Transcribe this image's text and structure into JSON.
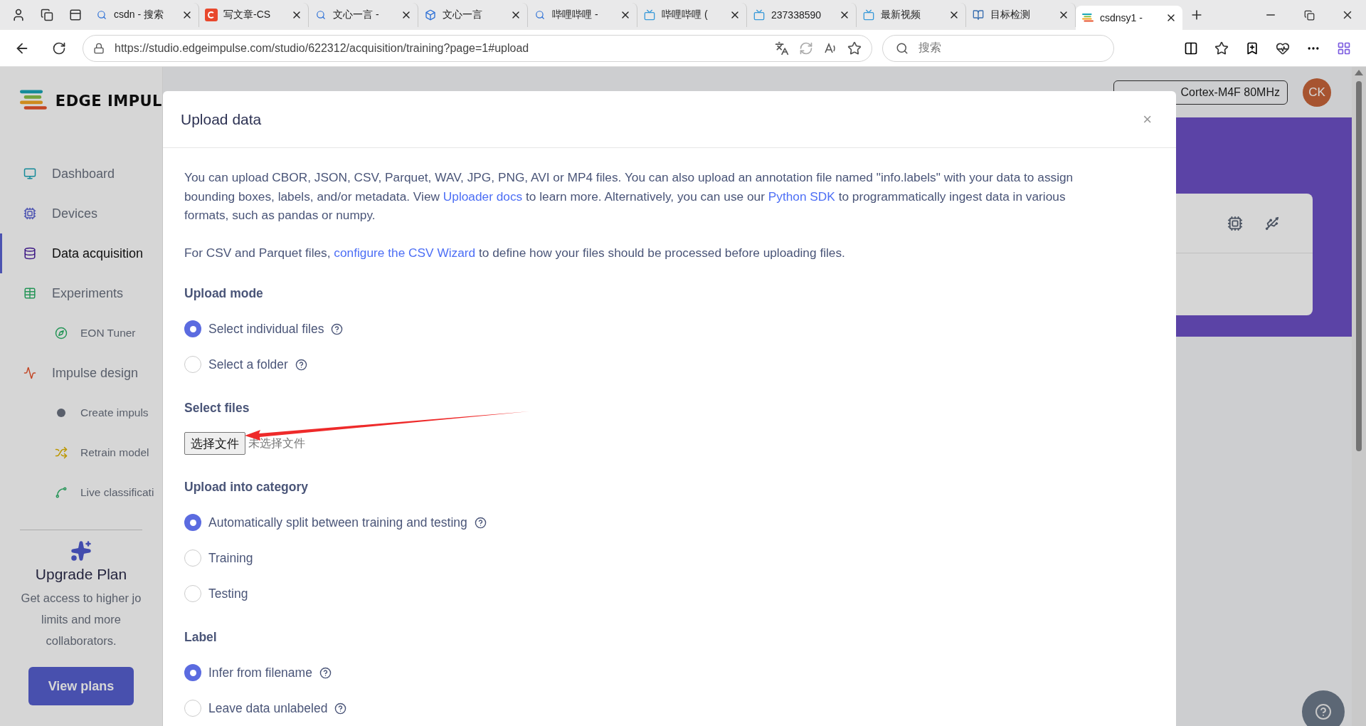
{
  "browser": {
    "tabs": [
      {
        "title": "csdn - 搜索",
        "kind": "search",
        "selected": false
      },
      {
        "title": "写文章-CS",
        "kind": "csdn",
        "selected": false
      },
      {
        "title": "文心一言 -",
        "kind": "search",
        "selected": false
      },
      {
        "title": "文心一言",
        "kind": "cube",
        "selected": false
      },
      {
        "title": "哔哩哔哩 -",
        "kind": "search",
        "selected": false
      },
      {
        "title": "哔哩哔哩 (",
        "kind": "tv",
        "selected": false
      },
      {
        "title": "237338590",
        "kind": "tv",
        "selected": false
      },
      {
        "title": "最新视频",
        "kind": "tv",
        "selected": false
      },
      {
        "title": "目标检测",
        "kind": "book",
        "selected": false
      },
      {
        "title": "csdnsy1 -",
        "kind": "logo",
        "selected": true
      }
    ],
    "url": "https://studio.edgeimpulse.com/studio/622312/acquisition/training?page=1#upload",
    "search_placeholder": "搜索"
  },
  "sidebar": {
    "logo_text": "EDGE IMPUL",
    "items": [
      {
        "label": "Dashboard",
        "kind": "dashboard",
        "sub": false,
        "selected": false
      },
      {
        "label": "Devices",
        "kind": "devices",
        "sub": false,
        "selected": false
      },
      {
        "label": "Data acquisition",
        "kind": "data",
        "sub": false,
        "selected": true
      },
      {
        "label": "Experiments",
        "kind": "experiments",
        "sub": false,
        "selected": false
      },
      {
        "label": "EON Tuner",
        "kind": "eon",
        "sub": true,
        "selected": false
      },
      {
        "label": "Impulse design",
        "kind": "impulse",
        "sub": false,
        "selected": false
      },
      {
        "label": "Create impuls",
        "kind": "create",
        "sub": true,
        "selected": false
      },
      {
        "label": "Retrain model",
        "kind": "retrain",
        "sub": true,
        "selected": false
      },
      {
        "label": "Live classificati",
        "kind": "live",
        "sub": true,
        "selected": false
      }
    ],
    "upgrade": {
      "title": "Upgrade Plan",
      "lines": [
        "Get access to higher jo",
        "limits and more",
        "collaborators."
      ],
      "button": "View plans"
    }
  },
  "header": {
    "target": "Cortex-M4F 80MHz",
    "avatar": "CK"
  },
  "modal": {
    "title": "Upload data",
    "close": "×",
    "intro": [
      {
        "text": "You can upload CBOR, JSON, CSV, Parquet, WAV, JPG, PNG, AVI or MP4 files. You can also upload an annotation file named \"info.labels\" with your data to assign bounding boxes, labels, and/or metadata. View ",
        "link": false
      },
      {
        "text": "Uploader docs",
        "link": true
      },
      {
        "text": " to learn more. Alternatively, you can use our ",
        "link": false
      },
      {
        "text": "Python SDK",
        "link": true
      },
      {
        "text": " to programmatically ingest data in various formats, such as pandas or numpy.",
        "link": false
      }
    ],
    "csv_note": [
      {
        "text": "For CSV and Parquet files, ",
        "link": false
      },
      {
        "text": "configure the CSV Wizard",
        "link": true
      },
      {
        "text": " to define how your files should be processed before uploading files.",
        "link": false
      }
    ],
    "sections": [
      {
        "title": "Upload mode",
        "kind": "radio",
        "options": [
          {
            "label": "Select individual files",
            "help": true,
            "selected": true
          },
          {
            "label": "Select a folder",
            "help": true,
            "selected": false
          }
        ]
      },
      {
        "title": "Select files",
        "kind": "file",
        "button": "选择文件",
        "status": "未选择文件"
      },
      {
        "title": "Upload into category",
        "kind": "radio",
        "options": [
          {
            "label": "Automatically split between training and testing",
            "help": true,
            "selected": true
          },
          {
            "label": "Training",
            "help": false,
            "selected": false
          },
          {
            "label": "Testing",
            "help": false,
            "selected": false
          }
        ]
      },
      {
        "title": "Label",
        "kind": "radio",
        "options": [
          {
            "label": "Infer from filename",
            "help": true,
            "selected": true
          },
          {
            "label": "Leave data unlabeled",
            "help": true,
            "selected": false
          }
        ]
      }
    ]
  }
}
